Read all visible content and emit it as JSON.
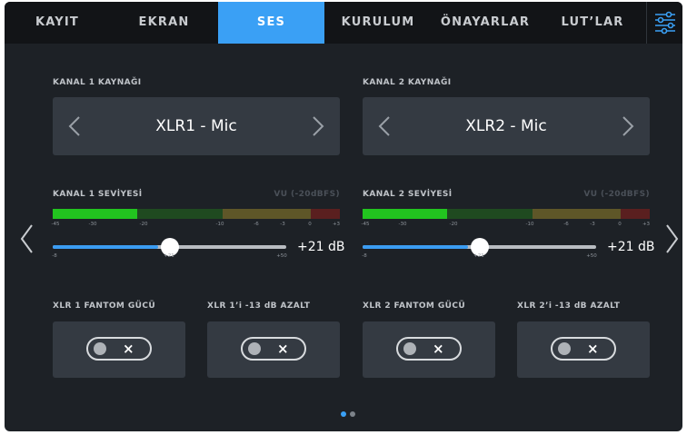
{
  "tabs": [
    {
      "label": "KAYIT",
      "active": false
    },
    {
      "label": "EKRAN",
      "active": false
    },
    {
      "label": "SES",
      "active": true
    },
    {
      "label": "KURULUM",
      "active": false
    },
    {
      "label": "ÖNAYARLAR",
      "active": false
    },
    {
      "label": "LUT’LAR",
      "active": false
    }
  ],
  "menu_icon": "sliders-icon",
  "channel1": {
    "source_label": "KANAL 1 KAYNAĞI",
    "source_value": "XLR1 - Mic",
    "level_label": "KANAL 1 SEVİYESİ",
    "vu_label": "VU (-20dBFS)",
    "meter_ticks": [
      "-45",
      "-30",
      "-20",
      "-10",
      "-6",
      "-3",
      "0",
      "+3"
    ],
    "slider_ticks": [
      "-8",
      "+21",
      "+50"
    ],
    "gain": "+21 dB",
    "gain_fraction": 0.45,
    "phantom_label": "XLR 1 FANTOM GÜCÜ",
    "phantom_on": false,
    "pad_label": "XLR 1’i -13 dB AZALT",
    "pad_on": false
  },
  "channel2": {
    "source_label": "KANAL 2 KAYNAĞI",
    "source_value": "XLR2 - Mic",
    "level_label": "KANAL 2 SEVİYESİ",
    "vu_label": "VU (-20dBFS)",
    "meter_ticks": [
      "-45",
      "-30",
      "-20",
      "-10",
      "-6",
      "-3",
      "0",
      "+3"
    ],
    "slider_ticks": [
      "-8",
      "+21",
      "+50"
    ],
    "gain": "+21 dB",
    "gain_fraction": 0.45,
    "phantom_label": "XLR 2 FANTOM GÜCÜ",
    "phantom_on": false,
    "pad_label": "XLR 2’i -13 dB AZALT",
    "pad_on": false
  },
  "toggle_off_symbol": "×",
  "pagination": {
    "pages": 2,
    "current": 1
  },
  "colors": {
    "accent": "#3aa0f5",
    "meter_green": "#22c41f",
    "meter_green_dim": "#1f4a20",
    "meter_yellow_dim": "#5e5628",
    "meter_red_dim": "#5a1f1f"
  }
}
